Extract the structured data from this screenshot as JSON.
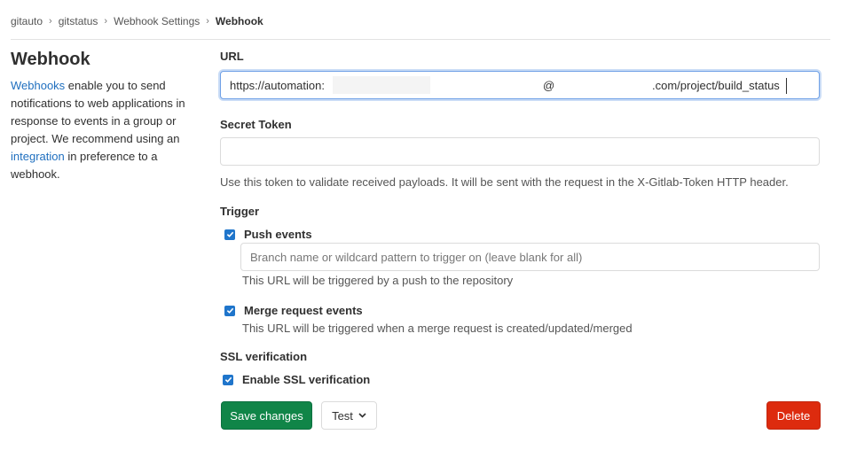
{
  "breadcrumb": {
    "items": [
      "gitauto",
      "gitstatus",
      "Webhook Settings"
    ],
    "current": "Webhook"
  },
  "sidebar": {
    "title": "Webhook",
    "desc_link1": "Webhooks",
    "desc_text1": " enable you to send notifications to web applications in response to events in a group or project. We recommend using an ",
    "desc_link2": "integration",
    "desc_text2": " in preference to a webhook."
  },
  "form": {
    "url_label": "URL",
    "url_part1": "https://automation:",
    "url_part2": "@",
    "url_part3": ".com/project/build_status",
    "secret_label": "Secret Token",
    "secret_value": "",
    "secret_help": "Use this token to validate received payloads. It will be sent with the request in the X-Gitlab-Token HTTP header.",
    "trigger_label": "Trigger",
    "push_label": "Push events",
    "push_checked": true,
    "branch_placeholder": "Branch name or wildcard pattern to trigger on (leave blank for all)",
    "push_help": "This URL will be triggered by a push to the repository",
    "merge_label": "Merge request events",
    "merge_checked": true,
    "merge_help": "This URL will be triggered when a merge request is created/updated/merged",
    "ssl_label": "SSL verification",
    "ssl_checkbox_label": "Enable SSL verification",
    "ssl_checked": true
  },
  "actions": {
    "save": "Save changes",
    "test": "Test",
    "delete": "Delete"
  },
  "colors": {
    "primary_green": "#108548",
    "danger_red": "#dd2b0e",
    "checkbox_blue": "#1f75cb",
    "link_blue": "#1f6fbf"
  }
}
